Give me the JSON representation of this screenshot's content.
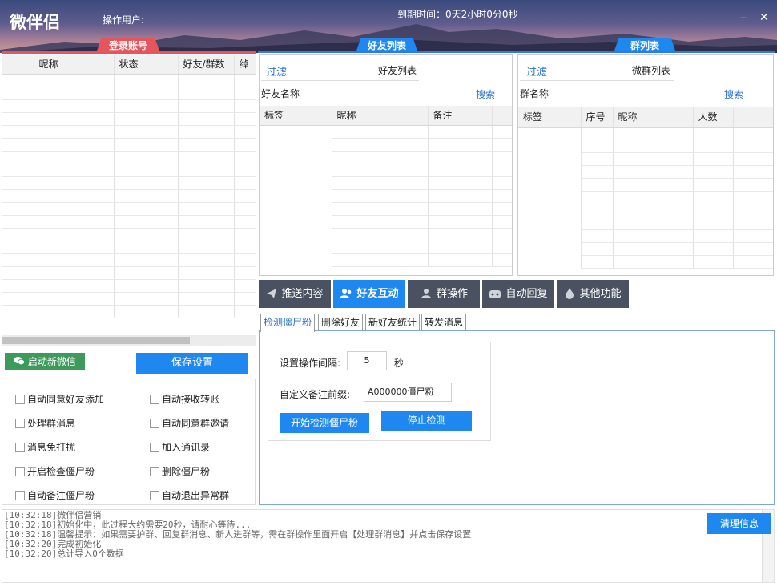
{
  "header": {
    "app_title": "微伴侣",
    "user_label": "操作用户:",
    "expire_label": "到期时间：0天2小时0分0秒",
    "minimize": "–",
    "close": "✕"
  },
  "tabs": {
    "accounts": "登录账号",
    "friends": "好友列表",
    "groups": "群列表"
  },
  "accounts": {
    "columns": [
      "",
      "昵称",
      "状态",
      "好友/群数",
      "绰"
    ],
    "row_count": 19
  },
  "friends": {
    "filter": "过滤",
    "list_title": "好友列表",
    "name_label": "好友名称",
    "search": "搜索",
    "columns": [
      "标签",
      "昵称",
      "备注",
      ""
    ]
  },
  "groups": {
    "filter": "过滤",
    "list_title": "微群列表",
    "name_label": "群名称",
    "search": "搜索",
    "columns": [
      "标签",
      "序号",
      "昵称",
      "人数",
      ""
    ]
  },
  "buttons": {
    "start_wechat": "启动新微信",
    "save_settings": "保存设置",
    "clear_info": "清理信息",
    "start_detect": "开始检测僵尸粉",
    "stop_detect": "停止检测"
  },
  "options": [
    {
      "label": "自动同意好友添加"
    },
    {
      "label": "自动接收转账"
    },
    {
      "label": "处理群消息"
    },
    {
      "label": "自动同意群邀请"
    },
    {
      "label": "消息免打扰"
    },
    {
      "label": "加入通讯录"
    },
    {
      "label": "开启检查僵尸粉"
    },
    {
      "label": "删除僵尸粉"
    },
    {
      "label": "自动备注僵尸粉"
    },
    {
      "label": "自动退出异常群"
    }
  ],
  "nav": [
    "推送内容",
    "好友互动",
    "群操作",
    "自动回复",
    "其他功能"
  ],
  "subtabs": [
    "检测僵尸粉",
    "删除好友",
    "新好友统计",
    "转发消息"
  ],
  "detect": {
    "interval_label": "设置操作间隔:",
    "interval_value": "5",
    "interval_unit": "秒",
    "prefix_label": "自定义备注前缀:",
    "prefix_value": "A000000僵尸粉"
  },
  "log_lines": [
    "[10:32:18]微伴侣营销",
    "[10:32:18]初始化中，此过程大约需要20秒，请耐心等待...",
    "[10:32:18]温馨提示：如果需要护群、回复群消息、新人进群等，需在群操作里面开启【处理群消息】并点击保存设置",
    "[10:32:20]完成初始化",
    "[10:32:20]总计导入0个数据"
  ],
  "colors": {
    "tab_red": "#e5555b",
    "tab_blue": "#1e88f0",
    "nav_dark": "#4a5261",
    "btn_green": "#3d9a5a"
  }
}
